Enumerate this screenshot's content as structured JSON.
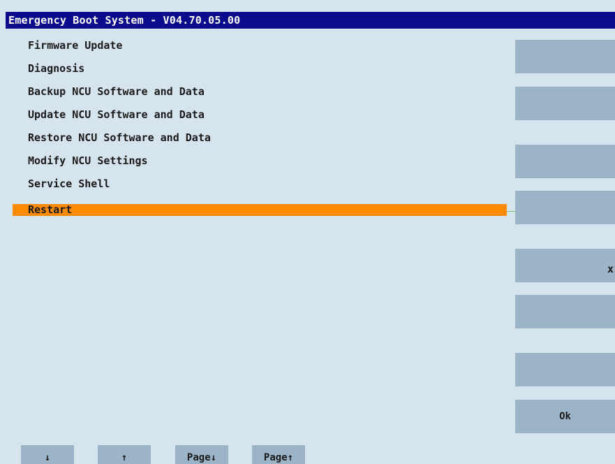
{
  "window": {
    "title": "Emergency Boot System - V04.70.05.00"
  },
  "menu": {
    "items": [
      {
        "label": "Firmware Update"
      },
      {
        "label": "Diagnosis"
      },
      {
        "label": "Backup NCU Software and Data"
      },
      {
        "label": "Update NCU Software and Data"
      },
      {
        "label": "Restore NCU Software and Data"
      },
      {
        "label": "Modify NCU Settings"
      },
      {
        "label": "Service Shell"
      },
      {
        "label": "Restart",
        "selected": true
      }
    ]
  },
  "softkeys": {
    "vertical": [
      {
        "label": ""
      },
      {
        "label": ""
      },
      {
        "label": ""
      },
      {
        "label": ""
      },
      {
        "label": "",
        "mark": "x"
      },
      {
        "label": ""
      },
      {
        "label": ""
      },
      {
        "label": "Ok"
      }
    ],
    "horizontal": [
      {
        "label": "↓"
      },
      {
        "label": "↑"
      },
      {
        "label": "Page↓"
      },
      {
        "label": "Page↑"
      }
    ]
  },
  "colors": {
    "background": "#d6e4ee",
    "titlebar": "#0a0a8c",
    "selection": "#ff8c00",
    "softkey": "#9cb4c8"
  }
}
